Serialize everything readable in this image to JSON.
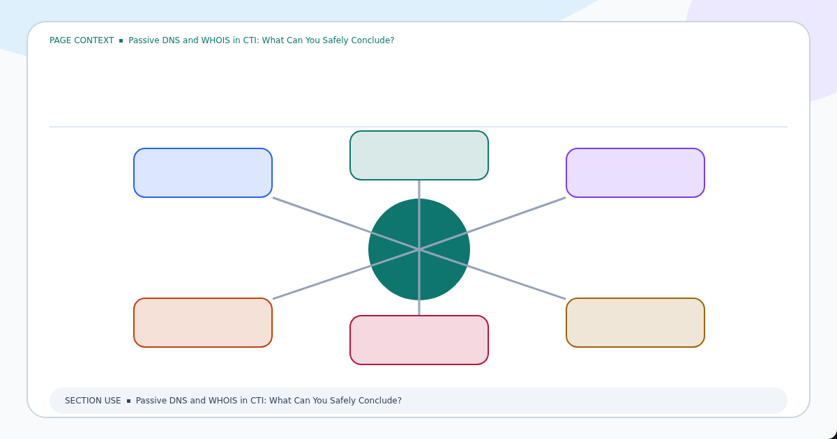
{
  "header": {
    "label": "PAGE CONTEXT",
    "title": "Passive DNS and WHOIS in CTI: What Can You Safely Conclude?"
  },
  "diagram": {
    "hub": {
      "color": "#0f766e"
    },
    "nodes": [
      {
        "color": "#2563eb"
      },
      {
        "color": "#0f766e"
      },
      {
        "color": "#7c3aed"
      },
      {
        "color": "#c2410c"
      },
      {
        "color": "#be123c"
      },
      {
        "color": "#a16207"
      }
    ]
  },
  "footer": {
    "label": "SECTION USE",
    "title": "Passive DNS and WHOIS in CTI: What Can You Safely Conclude?"
  }
}
